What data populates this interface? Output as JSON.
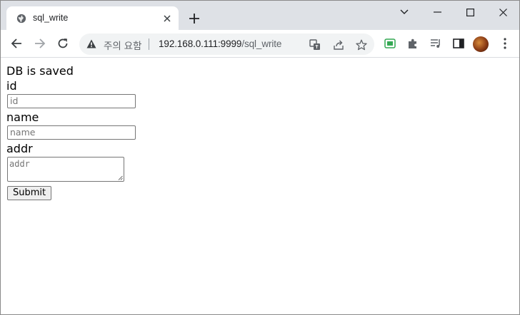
{
  "browser": {
    "tab": {
      "title": "sql_write",
      "favicon": "globe-icon"
    },
    "omnibox": {
      "security_label": "주의 요함",
      "url_host": "192.168.0.111:9999",
      "url_path": "/sql_write"
    }
  },
  "page": {
    "message": "DB is saved",
    "id_label": "id",
    "id_placeholder": "id",
    "name_label": "name",
    "name_placeholder": "name",
    "addr_label": "addr",
    "addr_placeholder": "addr",
    "submit_label": "Submit"
  }
}
